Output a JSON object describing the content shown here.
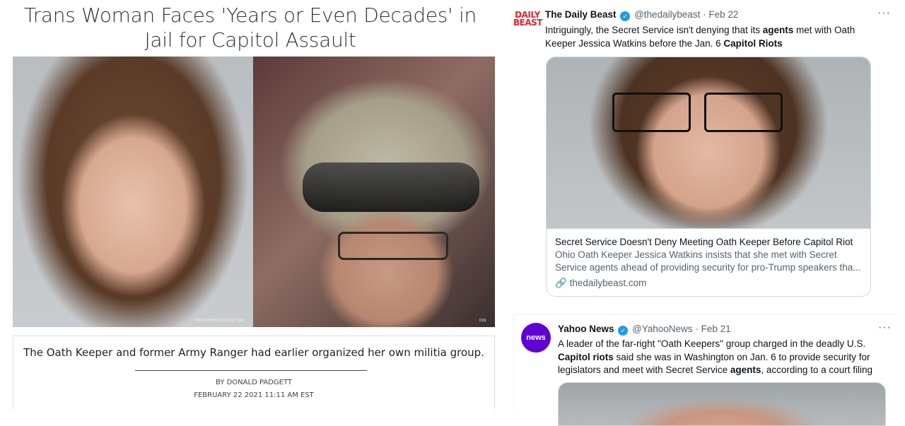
{
  "article": {
    "headline": "Trans Woman Faces 'Years or Even Decades' in Jail for Capitol Assault",
    "photo_left_credit": "MONTGOMERY COUNTY JAIL",
    "photo_right_credit": "DOJ",
    "caption": "The Oath Keeper and former Army Ranger had earlier organized her own militia group.",
    "byline": "BY DONALD PADGETT",
    "date": "FEBRUARY 22 2021 11:11 AM EST"
  },
  "tweets": [
    {
      "avatar_text": [
        "DAILY",
        "BEAST"
      ],
      "name": "The Daily Beast",
      "handle": "@thedailybeast",
      "sep": "·",
      "date": "Feb 22",
      "more": "···",
      "text_parts": [
        "Intriguingly, the Secret Service isn't denying that its ",
        "agents",
        " met with Oath Keeper Jessica Watkins before the Jan. 6 ",
        "Capitol Riots"
      ],
      "card": {
        "title": "Secret Service Doesn't Deny Meeting Oath Keeper Before Capitol Riot",
        "description": "Ohio Oath Keeper Jessica Watkins insists that she met with Secret Service agents ahead of providing security for pro-Trump speakers tha...",
        "link_icon": "link-icon",
        "domain": "thedailybeast.com"
      }
    },
    {
      "avatar_text": "news",
      "name": "Yahoo News",
      "handle": "@YahooNews",
      "sep": "·",
      "date": "Feb 21",
      "more": "···",
      "text_parts": [
        "A leader of the far-right \"Oath Keepers\" group charged in the deadly U.S. ",
        "Capitol riots",
        " said she was in Washington on Jan. 6 to provide security for legislators and meet with Secret Service ",
        "agents",
        ", according to a court filing"
      ]
    }
  ],
  "colors": {
    "verified": "#1d9bf0",
    "muted": "#536471",
    "yahoo": "#6001d2",
    "beast": "#e3242b"
  }
}
